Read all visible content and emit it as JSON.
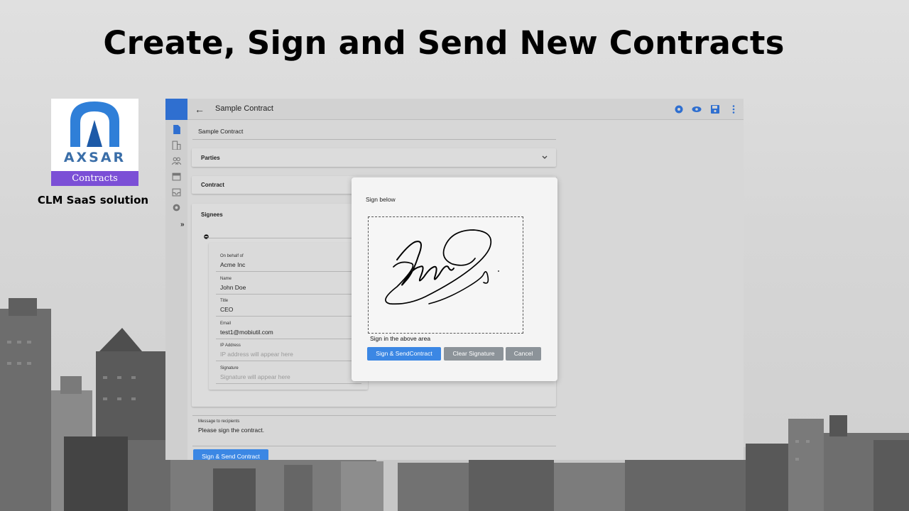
{
  "headline": "Create, Sign and Send New Contracts",
  "logo": {
    "word": "AXSAR",
    "band": "Contracts"
  },
  "tagline": "CLM SaaS solution",
  "app": {
    "title": "Sample Contract",
    "name_value": "Sample Contract",
    "sections": {
      "parties": "Parties",
      "contract": "Contract",
      "signees": "Signees"
    },
    "signee": {
      "on_behalf_label": "On behalf of",
      "on_behalf_value": "Acme Inc",
      "name_label": "Name",
      "name_value": "John Doe",
      "title_label": "Title",
      "title_value": "CEO",
      "email_label": "Email",
      "email_value": "test1@mobiutil.com",
      "ip_label": "IP Address",
      "ip_placeholder": "IP address will appear here",
      "signature_label": "Signature",
      "signature_placeholder": "Signature will appear here"
    },
    "message": {
      "label": "Message to recipients",
      "value": "Please sign the contract."
    },
    "primary_button": "Sign & Send Contract",
    "sidebar_expand": "»"
  },
  "modal": {
    "prompt": "Sign below",
    "hint": "Sign in the above area",
    "buttons": {
      "sign_send": "Sign & SendContract",
      "clear": "Clear Signature",
      "cancel": "Cancel"
    }
  },
  "colors": {
    "accent": "#2f6fd0",
    "button_blue": "#3b87e4",
    "button_gray": "#8c9399",
    "logo_purple": "#7b4fd6"
  },
  "icons": [
    "back-arrow-icon",
    "gear-icon",
    "eye-icon",
    "save-icon",
    "more-vert-icon",
    "document-icon",
    "building-icon",
    "people-icon",
    "calendar-icon",
    "inbox-icon",
    "settings-icon",
    "chevron-down-icon",
    "remove-circle-icon"
  ]
}
